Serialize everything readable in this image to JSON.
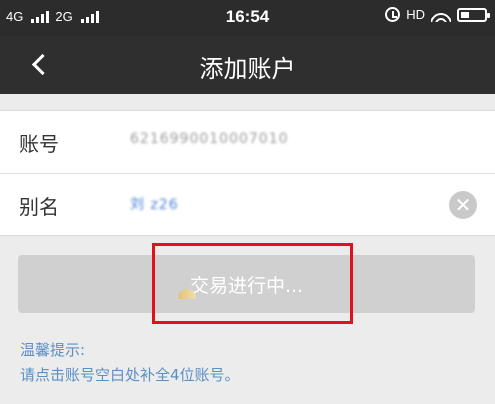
{
  "status_bar": {
    "network_1": "4G",
    "network_2": "2G",
    "time": "16:54",
    "hd_label": "HD",
    "icons": [
      "signal-icon",
      "alarm-icon",
      "wifi-icon",
      "battery-icon"
    ]
  },
  "header": {
    "title": "添加账户",
    "back_icon": "chevron-left-icon"
  },
  "form": {
    "account_label": "账号",
    "account_value": "6216990010007010",
    "alias_label": "别名",
    "alias_value": "刘 z26",
    "clear_icon": "close-circle-icon"
  },
  "submit": {
    "label": "交易进行中..."
  },
  "hint": {
    "title": "温馨提示:",
    "text": "请点击账号空白处补全4位账号。"
  },
  "colors": {
    "header_bg": "#2f2f2f",
    "button_disabled": "#d0d0d0",
    "hint_text": "#5b8fc6",
    "highlight": "#e0111b"
  }
}
